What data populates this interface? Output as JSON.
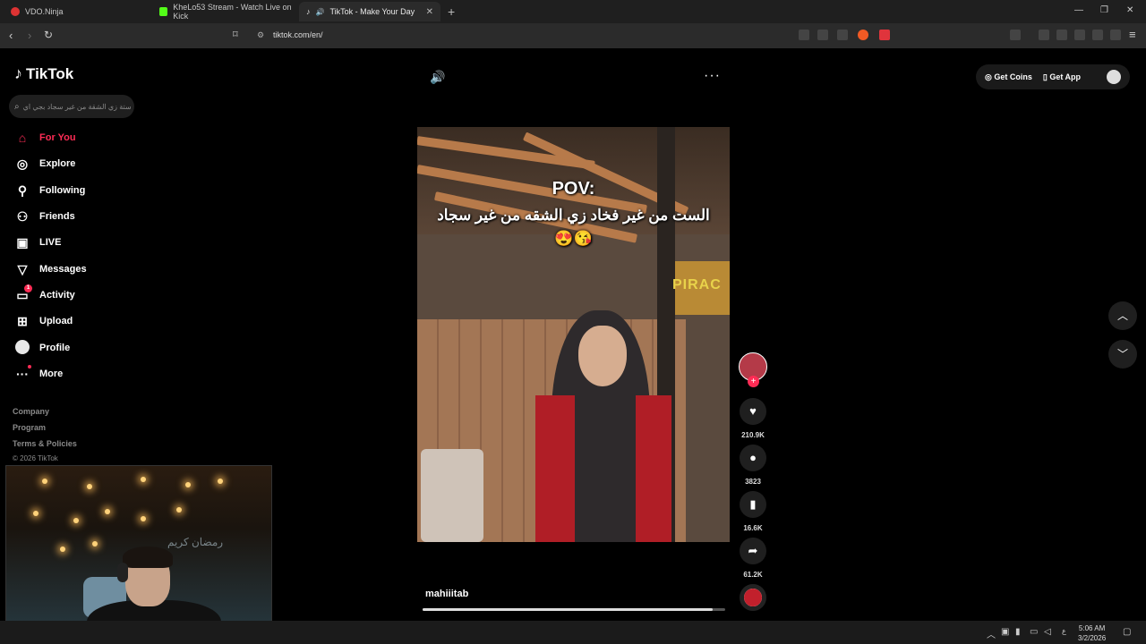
{
  "browser": {
    "tabs": [
      {
        "title": "VDO.Ninja",
        "color": "#d33"
      },
      {
        "title": "KheLo53 Stream - Watch Live on Kick",
        "color": "#53fc18"
      },
      {
        "title": "TikTok - Make Your Day",
        "color": "#fff"
      }
    ],
    "url": "tiktok.com/en/"
  },
  "tiktok": {
    "logo": "TikTok",
    "search_placeholder": "ستة زي الشقة من غير سجاد بجي اي",
    "nav": [
      {
        "label": "For You",
        "icon": "home-icon"
      },
      {
        "label": "Explore",
        "icon": "compass-icon"
      },
      {
        "label": "Following",
        "icon": "user-plus-icon"
      },
      {
        "label": "Friends",
        "icon": "friends-icon"
      },
      {
        "label": "LIVE",
        "icon": "live-tv-icon"
      },
      {
        "label": "Messages",
        "icon": "paper-plane-icon"
      },
      {
        "label": "Activity",
        "icon": "activity-icon",
        "badge": "1"
      },
      {
        "label": "Upload",
        "icon": "upload-icon"
      },
      {
        "label": "Profile",
        "icon": "avatar-icon"
      },
      {
        "label": "More",
        "icon": "more-dots-icon"
      }
    ],
    "footer": {
      "links": [
        "Company",
        "Program",
        "Terms & Policies"
      ],
      "copyright": "© 2026 TikTok"
    },
    "top_right": {
      "coins": "Get Coins",
      "app": "Get App"
    },
    "video": {
      "overlay_line1": "POV:",
      "overlay_line2": "الست من غير فخاد زي الشقه من غير سجاد 😘😍",
      "sign_text": "PIRAC",
      "username": "mahiiitab",
      "progress": 0.96
    },
    "actions": {
      "likes": "210.9K",
      "comments": "3823",
      "saves": "16.6K",
      "shares": "61.2K"
    }
  },
  "webcam": {
    "neon_text": "رمضان كريم"
  },
  "taskbar": {
    "time": "5:06 AM",
    "date": "3/2/2026"
  }
}
